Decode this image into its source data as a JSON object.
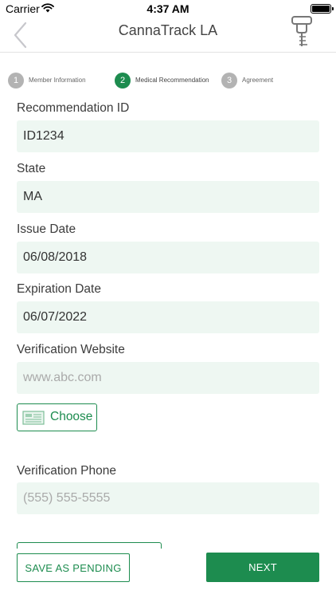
{
  "status_bar": {
    "carrier": "Carrier",
    "time": "4:37 AM",
    "battery_level": 1.0
  },
  "nav": {
    "title": "CannaTrack LA",
    "back_icon": "chevron-left-icon",
    "right_icon": "tool-icon"
  },
  "stepper": {
    "steps": [
      {
        "number": "1",
        "label": "Member Information",
        "active": false
      },
      {
        "number": "2",
        "label": "Medical Recommendation",
        "active": true
      },
      {
        "number": "3",
        "label": "Agreement",
        "active": false
      }
    ]
  },
  "form": {
    "recommendation_id": {
      "label": "Recommendation ID",
      "value": "ID1234",
      "placeholder": ""
    },
    "state": {
      "label": "State",
      "value": "MA",
      "placeholder": ""
    },
    "issue_date": {
      "label": "Issue Date",
      "value": "06/08/2018",
      "placeholder": ""
    },
    "expiration_date": {
      "label": "Expiration Date",
      "value": "06/07/2022",
      "placeholder": ""
    },
    "verification_website": {
      "label": "Verification Website",
      "value": "",
      "placeholder": "www.abc.com"
    },
    "choose_button": {
      "label": "Choose",
      "icon": "card-icon"
    },
    "verification_phone": {
      "label": "Verification Phone",
      "value": "",
      "placeholder": "(555) 555-5555"
    }
  },
  "actions": {
    "save_pending": "SAVE AS PENDING",
    "next": "NEXT"
  },
  "colors": {
    "accent": "#1d8c4f",
    "input_background": "#eef7f2",
    "step_inactive": "#b3b3b3"
  }
}
